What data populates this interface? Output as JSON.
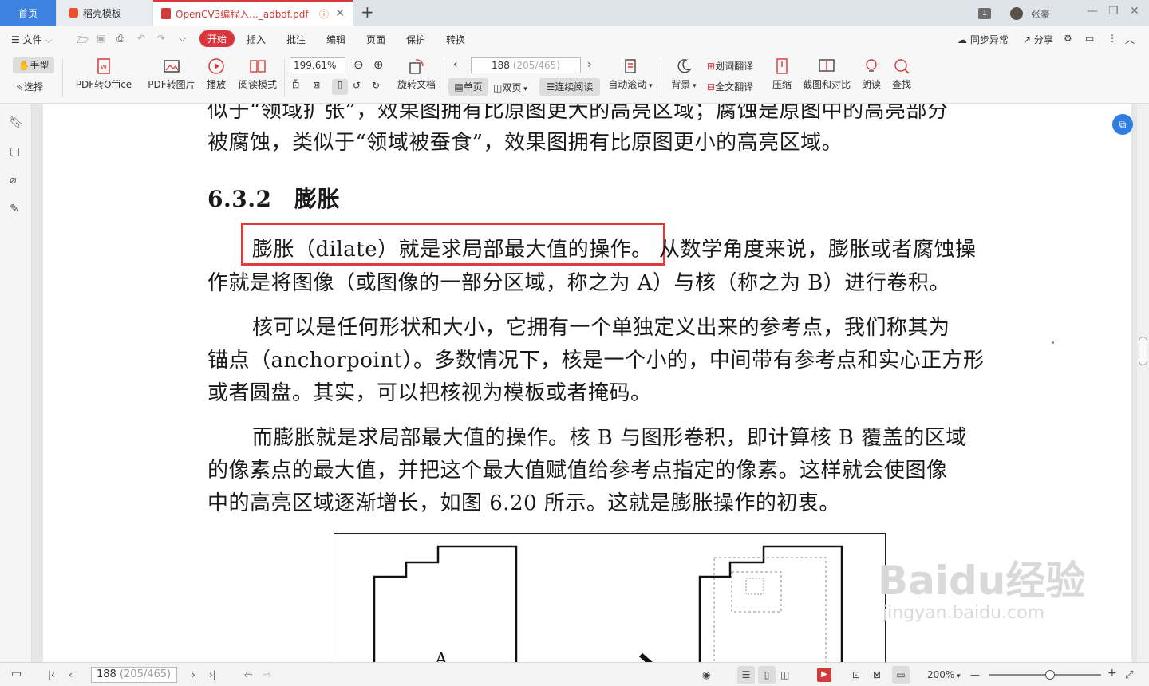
{
  "tabs": {
    "home": "首页",
    "template": "稻壳模板",
    "doc": "OpenCV3编程入..._adbdf.pdf"
  },
  "titlebar": {
    "badge": "1",
    "username": "张豪"
  },
  "menu": {
    "file": "文件",
    "items": [
      "开始",
      "插入",
      "批注",
      "编辑",
      "页面",
      "保护",
      "转换"
    ],
    "sync": "同步异常",
    "share": "分享"
  },
  "toolbar": {
    "hand": "手型",
    "select": "选择",
    "pdf_office": "PDF转Office",
    "pdf_image": "PDF转图片",
    "play": "播放",
    "read_mode": "阅读模式",
    "zoom": "199.61%",
    "rotate": "旋转文档",
    "page_current": "188",
    "page_total": "(205/465)",
    "single": "单页",
    "double": "双页",
    "continuous": "连续阅读",
    "auto_scroll": "自动滚动",
    "background": "背景",
    "word_translate": "划词翻译",
    "full_translate": "全文翻译",
    "compress": "压缩",
    "screenshot_compare": "截图和对比",
    "read_aloud": "朗读",
    "search": "查找"
  },
  "document": {
    "line0": "似于“领域扩张”，效果图拥有比原图更大的高亮区域；腐蚀是原图中的高亮部分",
    "line1": "被腐蚀，类似于“领域被蚕食”，效果图拥有比原图更小的高亮区域。",
    "heading": "6.3.2　膨胀",
    "p1_highlight": "膨胀（dilate）就是求局部最大值的操作。",
    "p1_rest": "从数学角度来说，膨胀或者腐蚀操",
    "p1_line2": "作就是将图像（或图像的一部分区域，称之为 A）与核（称之为 B）进行卷积。",
    "p2_line1": "核可以是任何形状和大小，它拥有一个单独定义出来的参考点，我们称其为",
    "p2_line2": "锚点（anchorpoint）。多数情况下，核是一个小的，中间带有参考点和实心正方形",
    "p2_line3": "或者圆盘。其实，可以把核视为模板或者掩码。",
    "p3_line1": "而膨胀就是求局部最大值的操作。核 B 与图形卷积，即计算核 B 覆盖的区域",
    "p3_line2": "的像素点的最大值，并把这个最大值赋值给参考点指定的像素。这样就会使图像",
    "p3_line3": "中的高亮区域逐渐增长，如图 6.20 所示。这就是膨胀操作的初衷。",
    "figure_label": "A"
  },
  "statusbar": {
    "page_current": "188",
    "page_total": "(205/465)",
    "zoom": "200%"
  },
  "watermark": {
    "brand": "Baidu经验",
    "url": "jingyan.baidu.com"
  },
  "colors": {
    "accent": "#d9363e",
    "tab_home": "#3c83e0",
    "highlight_box": "#e23a3a"
  }
}
